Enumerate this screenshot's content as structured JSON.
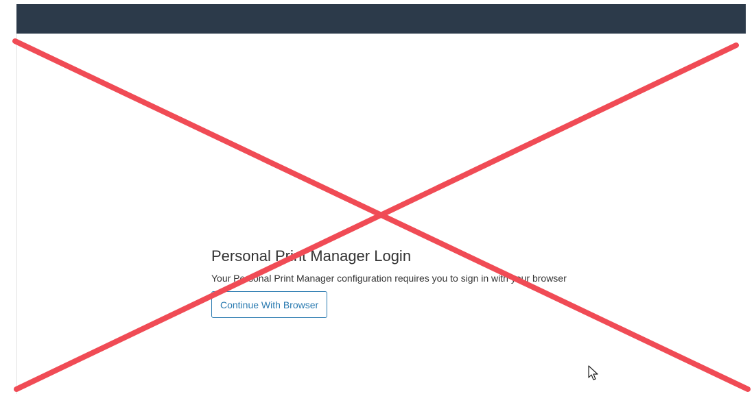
{
  "login": {
    "title": "Personal Print Manager Login",
    "description": "Your Personal Print Manager configuration requires you to sign in with your browser",
    "button_label": "Continue With Browser"
  },
  "colors": {
    "header": "#2c3a4a",
    "button_accent": "#2a7ab0",
    "cross_overlay": "#f04b55"
  },
  "icons": {
    "cross": "red-x-overlay",
    "cursor": "mouse-pointer-icon"
  }
}
